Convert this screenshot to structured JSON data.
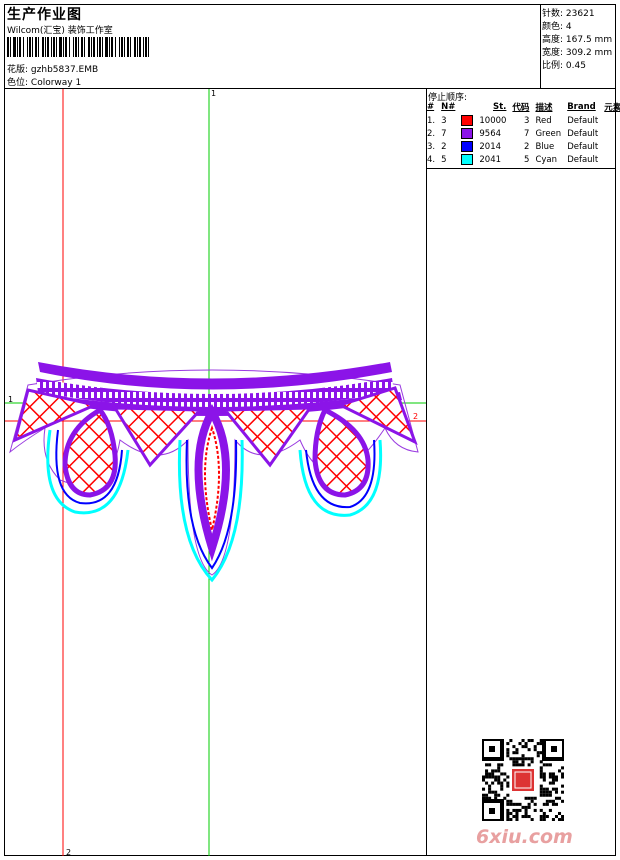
{
  "header": {
    "title": "生产作业图",
    "studio": "Wilcom(汇宝) 装饰工作室",
    "design_label": "花版:",
    "design_file": "gzhb5837.EMB",
    "colorway_label": "色位:",
    "colorway": "Colorway 1"
  },
  "stats": [
    {
      "label": "针数:",
      "value": "23621"
    },
    {
      "label": "颜色:",
      "value": "4"
    },
    {
      "label": "高度:",
      "value": "167.5 mm"
    },
    {
      "label": "宽度:",
      "value": "309.2 mm"
    },
    {
      "label": "比例:",
      "value": "0.45"
    }
  ],
  "color_table": {
    "title": "停止顺序:",
    "headers": [
      "#",
      "N#",
      "St.",
      "代码",
      "描述",
      "Brand",
      "元素"
    ],
    "rows": [
      {
        "order": "1.",
        "num": "3",
        "stitches": "10000",
        "code": "3",
        "desc": "Red",
        "brand": "Default",
        "color": "#ff0000"
      },
      {
        "order": "2.",
        "num": "7",
        "stitches": "9564",
        "code": "7",
        "desc": "Green",
        "brand": "Default",
        "color": "#8b14e8"
      },
      {
        "order": "3.",
        "num": "2",
        "stitches": "2014",
        "code": "2",
        "desc": "Blue",
        "brand": "Default",
        "color": "#0000ff"
      },
      {
        "order": "4.",
        "num": "5",
        "stitches": "2041",
        "code": "5",
        "desc": "Cyan",
        "brand": "Default",
        "color": "#00ffff"
      }
    ]
  },
  "guides": {
    "vertical_green_label": "1",
    "vertical_red_label": "2",
    "horizontal_green_label": "1",
    "horizontal_red_label": "2"
  },
  "watermark": "6xiu.com",
  "colors": {
    "red": "#ff0000",
    "purple": "#8b14e8",
    "blue": "#0000ff",
    "cyan": "#00ffff",
    "guide_green": "#00cc00",
    "guide_red": "#ff0000"
  },
  "icons": [
    "barcode-icon",
    "qr-code-icon",
    "seal-stamp-icon"
  ]
}
